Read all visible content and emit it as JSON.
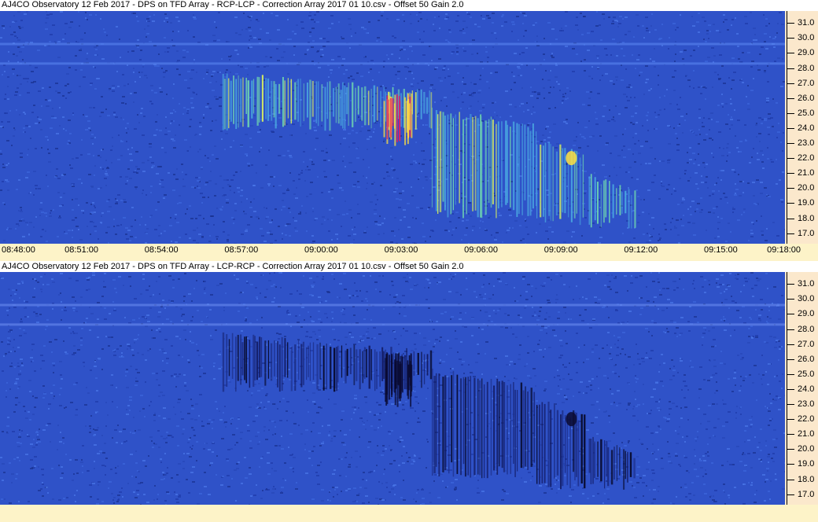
{
  "colors": {
    "background_blue": "#2f52c8",
    "strip_cream": "#fdf3c8",
    "axis_peach": "#fbe8cc",
    "emission_bright": "#ffe040",
    "emission_peak": "#e02060",
    "emission_dark": "#0a0a30"
  },
  "chart_data": [
    {
      "type": "heatmap",
      "title": "AJ4CO Observatory 12 Feb 2017  -  DPS on TFD Array  -  RCP-LCP  -  Correction Array 2017 01 10.csv  -  Offset 50  Gain 2.0",
      "x_ticks": [
        "08:48:00",
        "08:51:00",
        "08:54:00",
        "08:57:00",
        "09:00:00",
        "09:03:00",
        "09:06:00",
        "09:09:00",
        "09:12:00",
        "09:15:00",
        "09:18:00"
      ],
      "y_ticks": [
        "31.0",
        "30.0",
        "29.0",
        "28.0",
        "27.0",
        "26.0",
        "25.0",
        "24.0",
        "23.0",
        "22.0",
        "21.0",
        "20.0",
        "19.0",
        "18.0",
        "17.0"
      ],
      "xlim": [
        "08:48:00",
        "09:18:00"
      ],
      "ylim": [
        16.3,
        31.8
      ],
      "polarity": "bright"
    },
    {
      "type": "heatmap",
      "title": "AJ4CO Observatory 12 Feb 2017  -  DPS on TFD Array  -  LCP-RCP  -  Correction Array 2017 01 10.csv  -  Offset 50  Gain 2.0",
      "x_ticks": [],
      "y_ticks": [
        "31.0",
        "30.0",
        "29.0",
        "28.0",
        "27.0",
        "26.0",
        "25.0",
        "24.0",
        "23.0",
        "22.0",
        "21.0",
        "20.0",
        "19.0",
        "18.0",
        "17.0"
      ],
      "xlim": [
        "08:48:00",
        "09:18:00"
      ],
      "ylim": [
        16.3,
        31.8
      ],
      "polarity": "dark"
    }
  ]
}
